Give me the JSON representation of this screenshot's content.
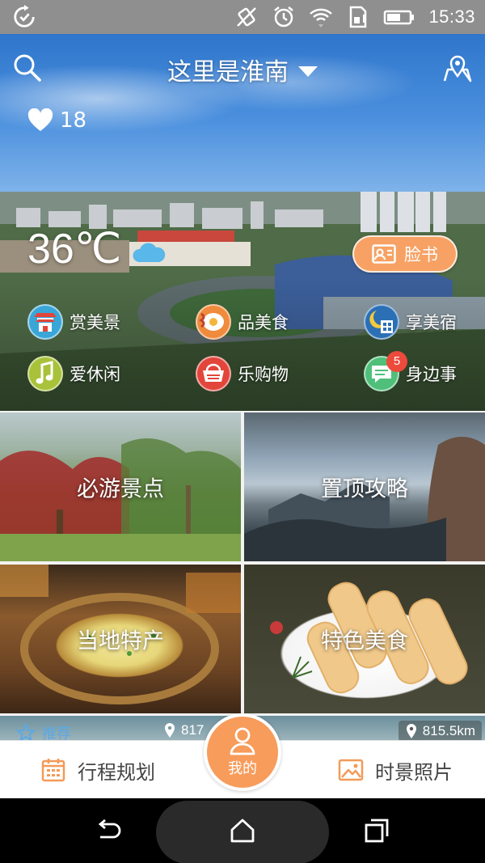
{
  "status_bar": {
    "time": "15:33"
  },
  "header": {
    "city_title": "这里是淮南",
    "likes_count": "18",
    "temperature": "36℃",
    "weather": "cloud-icon",
    "facebook_label": "脸书"
  },
  "categories": [
    {
      "label": "赏美景",
      "icon": "temple-icon",
      "color": "#3aa6d8"
    },
    {
      "label": "品美食",
      "icon": "egg-bacon-icon",
      "color": "#f08a3c"
    },
    {
      "label": "享美宿",
      "icon": "hotel-night-icon",
      "color": "#2b6fb5"
    },
    {
      "label": "爱休闲",
      "icon": "music-note-icon",
      "color": "#a8c23a"
    },
    {
      "label": "乐购物",
      "icon": "shopping-basket-icon",
      "color": "#e2453a"
    },
    {
      "label": "身边事",
      "icon": "chat-bubble-icon",
      "color": "#4fbf7a",
      "badge": "5"
    }
  ],
  "tiles": [
    {
      "label": "必游景点"
    },
    {
      "label": "置顶攻略"
    },
    {
      "label": "当地特产"
    },
    {
      "label": "特色美食"
    }
  ],
  "feed_strip": {
    "recommend_label": "推荐",
    "distance_left": "817",
    "distance_right": "815.5km"
  },
  "tab_bar": {
    "plan_label": "行程规划",
    "mine_label": "我的",
    "photos_label": "时景照片"
  },
  "colors": {
    "accent": "#f79c5b",
    "tab_icon": "#f39a58",
    "badge": "#ec4a3b"
  }
}
